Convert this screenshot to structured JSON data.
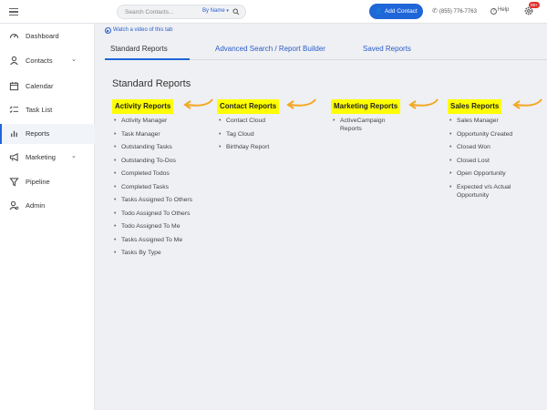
{
  "header": {
    "search_placeholder": "Search Contacts...",
    "search_mode": "By Name",
    "add_contact_label": "Add Contact",
    "phone": "(855) 776-7763",
    "help_label": "Help",
    "notification_badge": "99+"
  },
  "sidebar": {
    "items": [
      {
        "label": "Dashboard",
        "icon": "dashboard-icon"
      },
      {
        "label": "Contacts",
        "icon": "user-icon"
      },
      {
        "label": "Calendar",
        "icon": "calendar-icon"
      },
      {
        "label": "Task List",
        "icon": "checklist-icon"
      },
      {
        "label": "Reports",
        "icon": "bar-chart-icon"
      },
      {
        "label": "Marketing",
        "icon": "megaphone-icon"
      },
      {
        "label": "Pipeline",
        "icon": "funnel-icon"
      },
      {
        "label": "Admin",
        "icon": "admin-user-icon"
      }
    ],
    "active": "Reports"
  },
  "main": {
    "video_link": "Watch a video of this tab",
    "tabs": [
      {
        "label": "Standard Reports"
      },
      {
        "label": "Advanced Search / Report Builder"
      },
      {
        "label": "Saved Reports"
      }
    ],
    "section_title": "Standard Reports",
    "columns": [
      {
        "heading": "Activity Reports",
        "items": [
          "Activity Manager",
          "Task Manager",
          "Outstanding Tasks",
          "Outstanding To-Dos",
          "Completed Todos",
          "Completed Tasks",
          "Tasks Assigned To Others",
          "Todo Assigned To Others",
          "Todo Assigned To Me",
          "Tasks Assigned To Me",
          "Tasks By Type"
        ]
      },
      {
        "heading": "Contact Reports",
        "items": [
          "Contact Cloud",
          "Tag Cloud",
          "Birthday Report"
        ]
      },
      {
        "heading": "Marketing Reports",
        "items": [
          "ActiveCampaign Reports"
        ]
      },
      {
        "heading": "Sales Reports",
        "items": [
          "Sales Manager",
          "Opportunity Created",
          "Closed Won",
          "Closed Lost",
          "Open Opportunity",
          "Expected v/s Actual Opportunity"
        ]
      }
    ],
    "highlight_color": "#ffff00",
    "arrow_color": "#f5a623"
  }
}
